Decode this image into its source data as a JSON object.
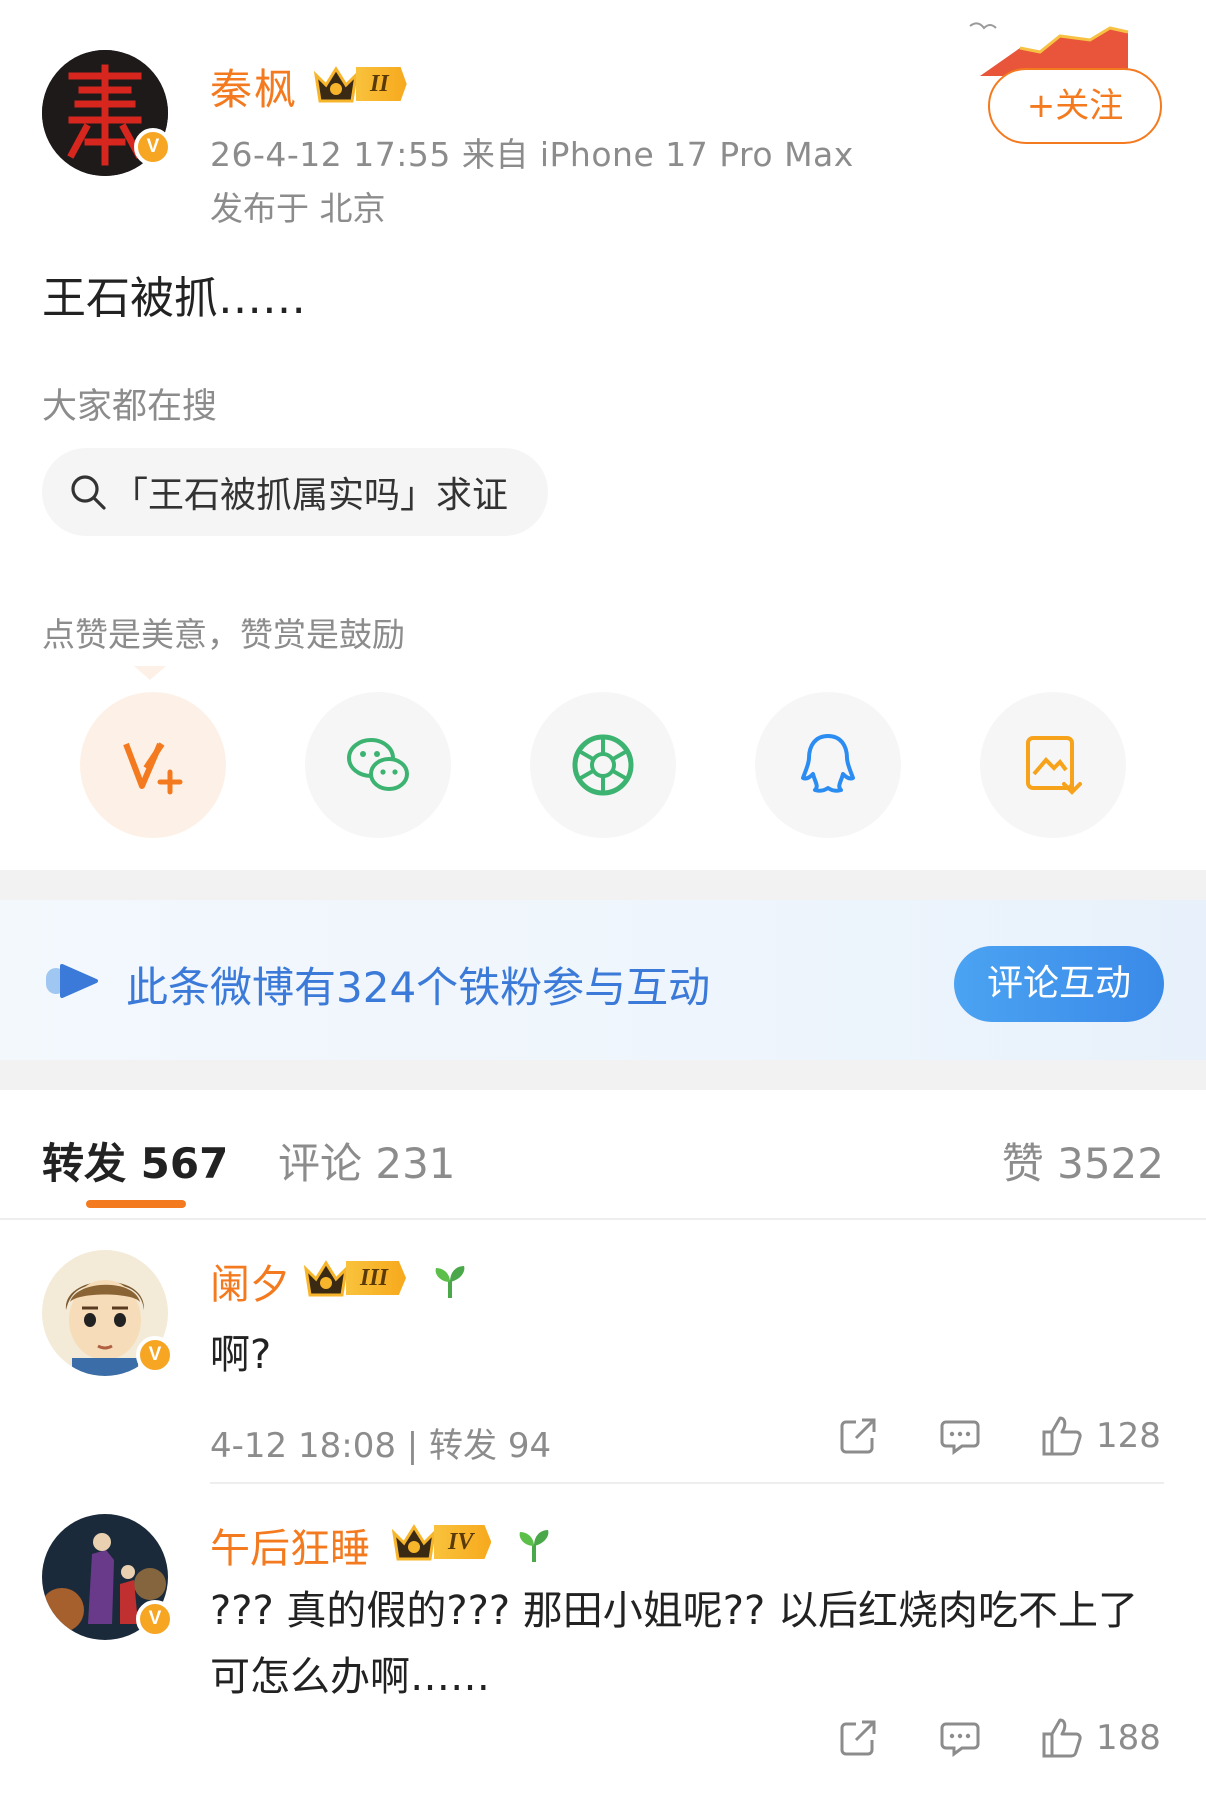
{
  "post": {
    "author": "秦枫",
    "badge_level": "II",
    "meta": "26-4-12 17:55  来自 iPhone 17 Pro Max",
    "location": "发布于 北京",
    "follow_label": "+关注",
    "text": "王石被抓……",
    "search_hint": "大家都在搜",
    "search_query": "「王石被抓属实吗」求证",
    "reward_hint": "点赞是美意，赞赏是鼓励"
  },
  "share": [
    {
      "icon": "weibo-reward-icon"
    },
    {
      "icon": "wechat-icon"
    },
    {
      "icon": "moments-icon"
    },
    {
      "icon": "qq-icon"
    },
    {
      "icon": "save-image-icon"
    }
  ],
  "fans_banner": {
    "text": "此条微博有324个铁粉参与互动",
    "button": "评论互动"
  },
  "tabs": {
    "repost": "转发 567",
    "comment": "评论 231",
    "like": "赞 3522"
  },
  "reposts": [
    {
      "name": "阑夕",
      "badge_level": "III",
      "text": "啊?",
      "meta": "4-12 18:08 | 转发 94",
      "likes": "128"
    },
    {
      "name": "午后狂睡",
      "badge_level": "IV",
      "text": "??? 真的假的??? 那田小姐呢?? 以后红烧肉吃不上了可怎么办啊……",
      "likes": "188"
    }
  ],
  "colors": {
    "accent": "#f47a1f",
    "link_blue": "#3b7ad8",
    "muted": "#8c8c8c"
  }
}
